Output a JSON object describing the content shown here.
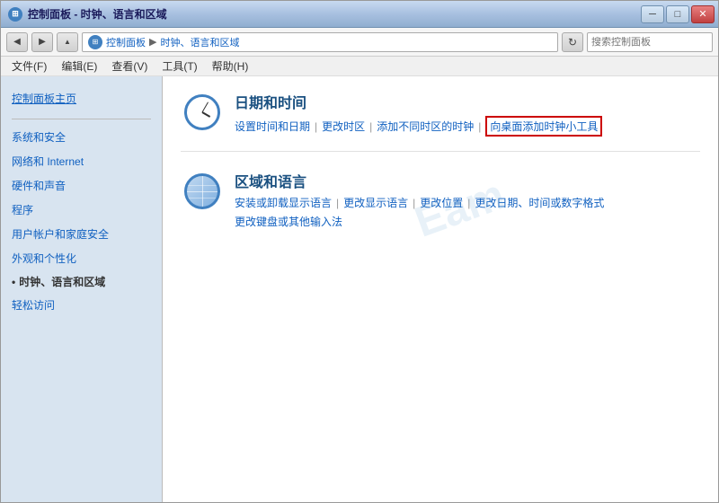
{
  "window": {
    "title": "控制面板 - 时钟、语言和区域",
    "minimize_label": "─",
    "restore_label": "□",
    "close_label": "✕"
  },
  "address_bar": {
    "path_root": "控制面板",
    "path_sep": "▶",
    "path_current": "时钟、语言和区域",
    "search_placeholder": "搜索控制面板",
    "back_label": "◀",
    "forward_label": "▶",
    "refresh_label": "↻"
  },
  "menu": {
    "items": [
      "文件(F)",
      "编辑(E)",
      "查看(V)",
      "工具(T)",
      "帮助(H)"
    ]
  },
  "sidebar": {
    "main_link": "控制面板主页",
    "items": [
      {
        "id": "system",
        "label": "系统和安全",
        "active": false
      },
      {
        "id": "network",
        "label": "网络和 Internet",
        "active": false
      },
      {
        "id": "hardware",
        "label": "硬件和声音",
        "active": false
      },
      {
        "id": "programs",
        "label": "程序",
        "active": false
      },
      {
        "id": "user-accounts",
        "label": "用户帐户和家庭安全",
        "active": false
      },
      {
        "id": "appearance",
        "label": "外观和个性化",
        "active": false
      },
      {
        "id": "clock-lang",
        "label": "时钟、语言和区域",
        "active": true
      },
      {
        "id": "accessibility",
        "label": "轻松访问",
        "active": false
      }
    ]
  },
  "content": {
    "sections": [
      {
        "id": "datetime",
        "title": "日期和时间",
        "links": [
          {
            "id": "set-time",
            "label": "设置时间和日期"
          },
          {
            "id": "change-timezone",
            "label": "更改时区"
          },
          {
            "id": "add-clock",
            "label": "添加不同时区的时钟"
          },
          {
            "id": "add-clock-tool",
            "label": "向桌面添加时钟小工具",
            "highlighted": true
          }
        ]
      },
      {
        "id": "region-lang",
        "title": "区域和语言",
        "links": [
          {
            "id": "install-language",
            "label": "安装或卸载显示语言"
          },
          {
            "id": "change-display-lang",
            "label": "更改显示语言"
          },
          {
            "id": "change-location",
            "label": "更改位置"
          },
          {
            "id": "change-date-format",
            "label": "更改日期、时间或数字格式"
          }
        ],
        "sub_links": [
          {
            "id": "change-keyboard",
            "label": "更改键盘或其他输入法"
          }
        ]
      }
    ]
  },
  "watermark": "Eam"
}
